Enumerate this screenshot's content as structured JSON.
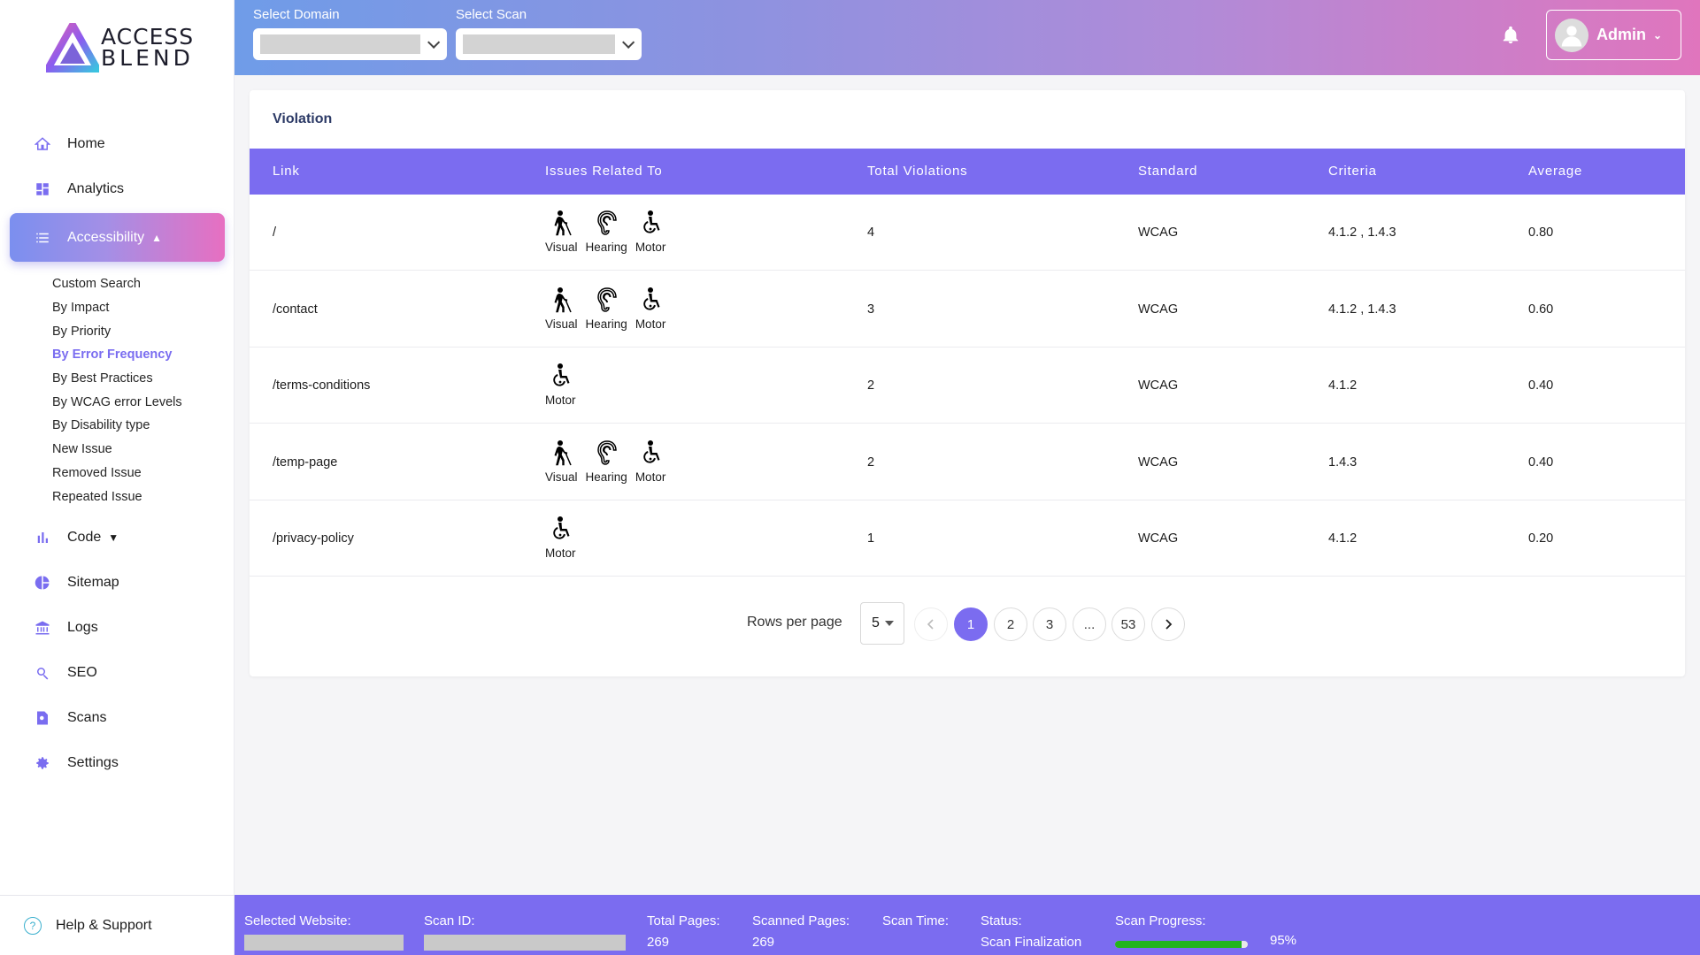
{
  "brand": {
    "line1": "ACCESS",
    "line2": "BLEND"
  },
  "sidebar": {
    "items": [
      {
        "label": "Home",
        "icon": "home-icon"
      },
      {
        "label": "Analytics",
        "icon": "dashboard-icon"
      },
      {
        "label": "Accessibility",
        "icon": "list-icon"
      },
      {
        "label": "Code",
        "icon": "bar-chart-icon"
      },
      {
        "label": "Sitemap",
        "icon": "pie-chart-icon"
      },
      {
        "label": "Logs",
        "icon": "bank-icon"
      },
      {
        "label": "SEO",
        "icon": "search-icon"
      },
      {
        "label": "Scans",
        "icon": "document-search-icon"
      },
      {
        "label": "Settings",
        "icon": "gear-icon"
      }
    ],
    "sub_items": [
      "Custom Search",
      "By Impact",
      "By Priority",
      "By Error Frequency",
      "By Best Practices",
      "By WCAG error Levels",
      "By Disability type",
      "New Issue",
      "Removed Issue",
      "Repeated Issue"
    ],
    "selected_sub": "By Error Frequency",
    "help": "Help & Support"
  },
  "topbar": {
    "domain_label": "Select Domain",
    "scan_label": "Select Scan",
    "user": "Admin"
  },
  "card": {
    "title": "Violation",
    "columns": [
      "Link",
      "Issues Related To",
      "Total Violations",
      "Standard",
      "Criteria",
      "Average"
    ],
    "rows": [
      {
        "link": "/",
        "issues": [
          "Visual",
          "Hearing",
          "Motor"
        ],
        "total": "4",
        "standard": "WCAG",
        "criteria": "4.1.2  , 1.4.3",
        "average": "0.80"
      },
      {
        "link": "/contact",
        "issues": [
          "Visual",
          "Hearing",
          "Motor"
        ],
        "total": "3",
        "standard": "WCAG",
        "criteria": "4.1.2  , 1.4.3",
        "average": "0.60"
      },
      {
        "link": "/terms-conditions",
        "issues": [
          "Motor"
        ],
        "total": "2",
        "standard": "WCAG",
        "criteria": "4.1.2",
        "average": "0.40"
      },
      {
        "link": "/temp-page",
        "issues": [
          "Visual",
          "Hearing",
          "Motor"
        ],
        "total": "2",
        "standard": "WCAG",
        "criteria": "1.4.3",
        "average": "0.40"
      },
      {
        "link": "/privacy-policy",
        "issues": [
          "Motor"
        ],
        "total": "1",
        "standard": "WCAG",
        "criteria": "4.1.2",
        "average": "0.20"
      }
    ]
  },
  "pagination": {
    "rows_label": "Rows per page",
    "rows_value": "5",
    "pages": [
      "1",
      "2",
      "3",
      "...",
      "53"
    ],
    "current": "1"
  },
  "footer": {
    "website_label": "Selected Website:",
    "scan_id_label": "Scan ID:",
    "total_pages_label": "Total Pages:",
    "total_pages": "269",
    "scanned_pages_label": "Scanned Pages:",
    "scanned_pages": "269",
    "scan_time_label": "Scan Time:",
    "status_label": "Status:",
    "status": "Scan Finalization",
    "progress_label": "Scan Progress:",
    "progress_text": "95%",
    "progress_value": 0.95
  },
  "colors": {
    "accent": "#7b6cf0",
    "progress": "#22b41c"
  }
}
